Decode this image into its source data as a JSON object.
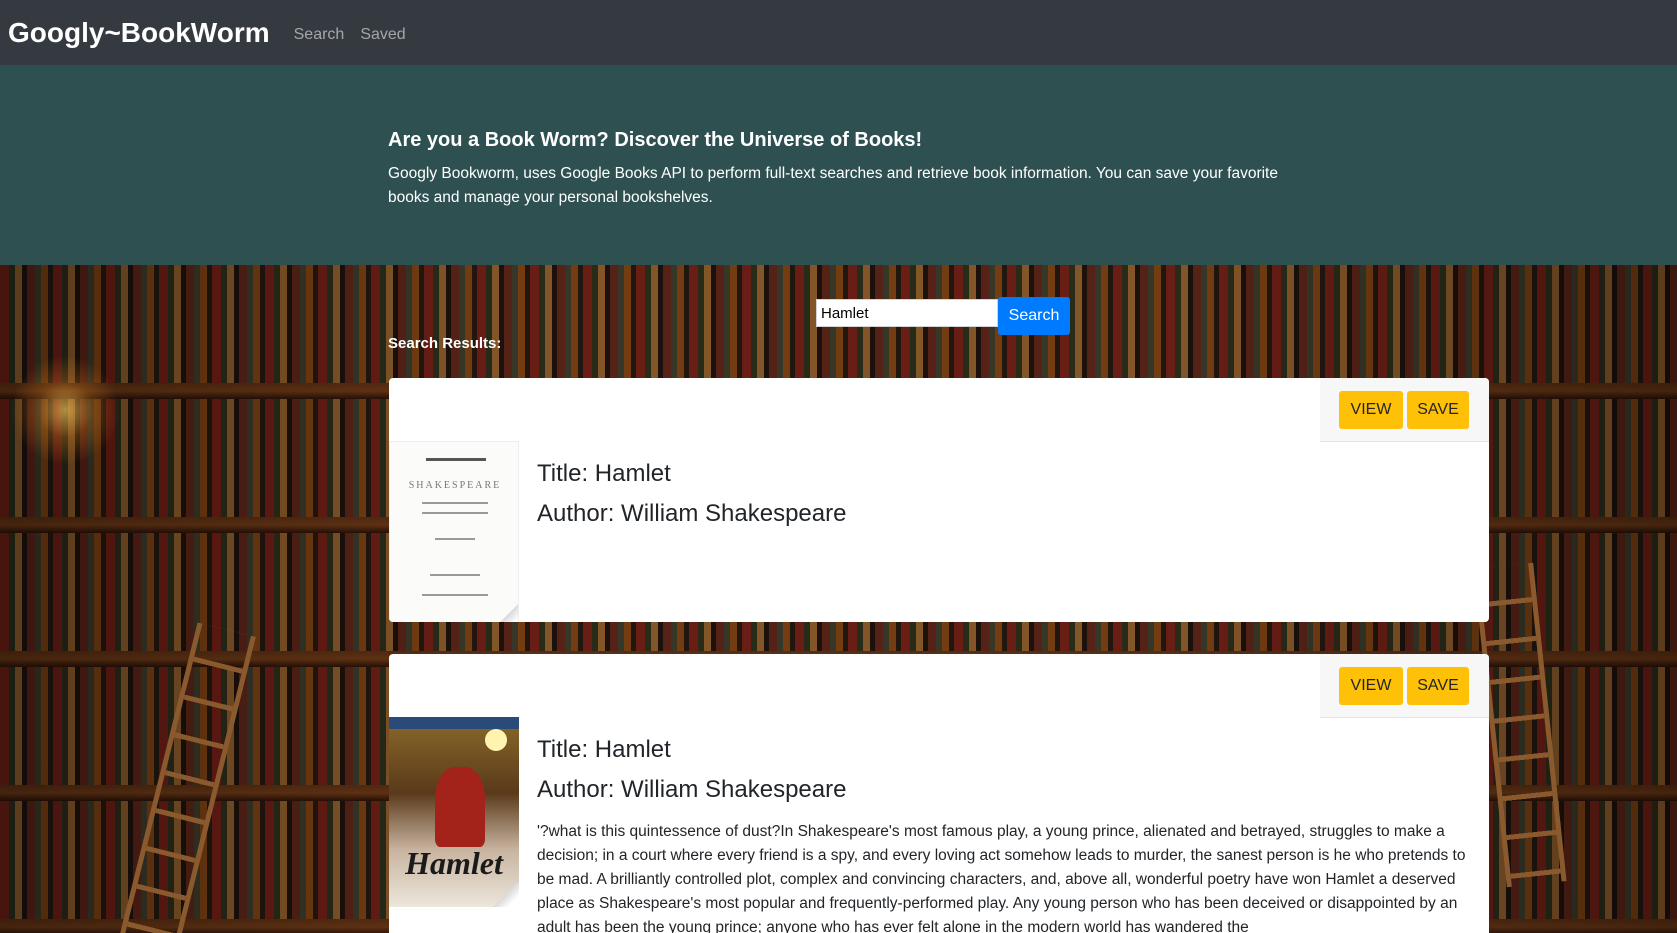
{
  "navbar": {
    "brand": "Googly~BookWorm",
    "links": [
      "Search",
      "Saved"
    ]
  },
  "hero": {
    "title": "Are you a Book Worm? Discover the Universe of Books!",
    "description": "Googly Bookworm, uses Google Books API to perform full-text searches and retrieve book information. You can save your favorite books and manage your personal bookshelves."
  },
  "search": {
    "value": "Hamlet",
    "button_label": "Search"
  },
  "results": {
    "label": "Search Results:",
    "items": [
      {
        "title": "Title: Hamlet",
        "author": "Author: William Shakespeare",
        "cover_text": "SHAKESPEARE",
        "description": "",
        "view_label": "VIEW",
        "save_label": "SAVE"
      },
      {
        "title": "Title: Hamlet",
        "author": "Author: William Shakespeare",
        "cover_text": "Hamlet",
        "description": "'?what is this quintessence of dust?In Shakespeare's most famous play, a young prince, alienated and betrayed, struggles to make a decision; in a court where every friend is a spy, and every loving act somehow leads to murder, the sanest person is he who pretends to be mad. A brilliantly controlled plot, complex and convincing characters, and, above all, wonderful poetry have won Hamlet a deserved place as Shakespeare's most popular and frequently-performed play. Any young person who has been deceived or disappointed by an adult has been the young prince; anyone who has ever felt alone in the modern world has wandered the",
        "view_label": "VIEW",
        "save_label": "SAVE"
      }
    ]
  },
  "colors": {
    "navbar": "#343a40",
    "hero": "#2e5051",
    "primary": "#007bff",
    "warning": "#ffc107"
  }
}
